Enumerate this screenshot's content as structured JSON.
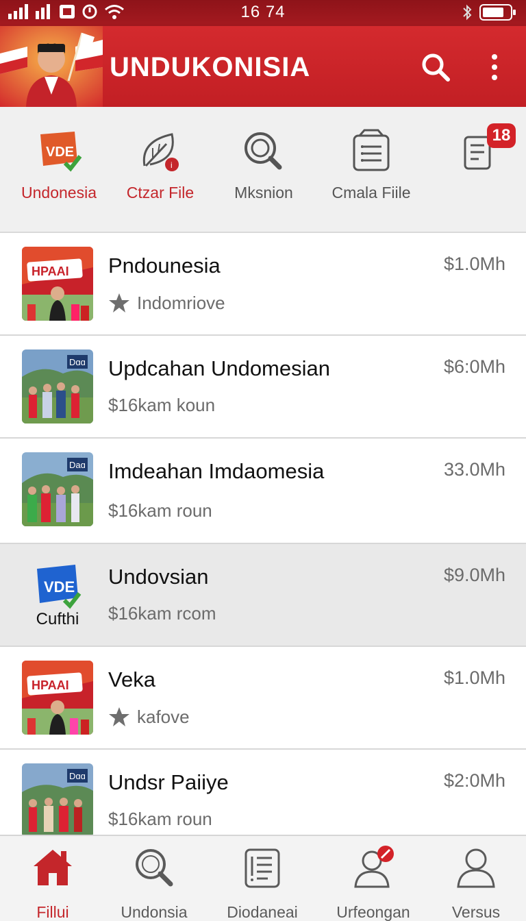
{
  "status_bar": {
    "time": "16 74"
  },
  "app": {
    "title": "UNDUKONISIA"
  },
  "quick_actions": [
    {
      "label": "Undonesia",
      "icon": "vde-badge-icon",
      "badge_text": "VDE"
    },
    {
      "label": "Ctzar File",
      "icon": "leaf-icon"
    },
    {
      "label": "Mksnion",
      "icon": "magnifier-icon"
    },
    {
      "label": "Cmala Fiile",
      "icon": "clipboard-list-icon"
    },
    {
      "label": "",
      "icon": "document-icon",
      "badge": "18"
    }
  ],
  "list": [
    {
      "title": "Pndounesia",
      "subtitle": "Indomriove",
      "price": "$1.0Mh",
      "thumb_text": "HPAAI",
      "starred": true
    },
    {
      "title": "Updcahan Undomesian",
      "subtitle": "$16kam koun",
      "price": "$6:0Mh",
      "thumb_text": "Dɑɑ",
      "starred": false
    },
    {
      "title": "Imdeahan Imdaomesia",
      "subtitle": "$16kam roun",
      "price": "33.0Mh",
      "thumb_text": "Daɑ",
      "starred": false
    },
    {
      "title": "Undovsian",
      "subtitle": "$16kam rcom",
      "price": "$9.0Mh",
      "thumb_text": "VDE",
      "thumb_caption": "Cufthi",
      "starred": false
    },
    {
      "title": "Veka",
      "subtitle": "kafove",
      "price": "$1.0Mh",
      "thumb_text": "HPAAI",
      "starred": true
    },
    {
      "title": "Undsr Paiiye",
      "subtitle": "$16kam roun",
      "price": "$2:0Mh",
      "thumb_text": "Dɑɑ",
      "starred": false
    }
  ],
  "bottom_nav": [
    {
      "label": "Fillui",
      "icon": "home-icon",
      "active": true
    },
    {
      "label": "Undonsia",
      "icon": "search-icon"
    },
    {
      "label": "Diodaneai",
      "icon": "document-list-icon"
    },
    {
      "label": "Urfeongan",
      "icon": "user-alert-icon"
    },
    {
      "label": "Versus",
      "icon": "user-icon"
    }
  ],
  "colors": {
    "brand_red": "#c4262b",
    "status_bar": "#a51a20",
    "text_muted": "#6b6b6b"
  }
}
